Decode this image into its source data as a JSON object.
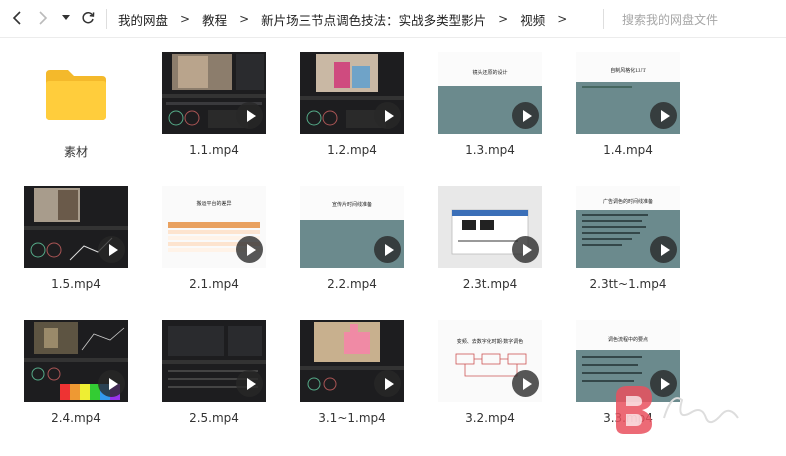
{
  "nav": {
    "back_icon": "chevron-left-icon",
    "forward_icon": "chevron-right-icon",
    "history_icon": "caret-down-icon",
    "refresh_icon": "refresh-icon"
  },
  "breadcrumb": [
    "我的网盘",
    "教程",
    "新片场三节点调色技法：实战多类型影片",
    "视频"
  ],
  "breadcrumb_separator": ">",
  "search": {
    "placeholder": "搜索我的网盘文件"
  },
  "items": [
    {
      "name": "素材",
      "type": "folder"
    },
    {
      "name": "1.1.mp4",
      "type": "video"
    },
    {
      "name": "1.2.mp4",
      "type": "video"
    },
    {
      "name": "1.3.mp4",
      "type": "video"
    },
    {
      "name": "1.4.mp4",
      "type": "video"
    },
    {
      "name": "1.5.mp4",
      "type": "video"
    },
    {
      "name": "2.1.mp4",
      "type": "video"
    },
    {
      "name": "2.2.mp4",
      "type": "video"
    },
    {
      "name": "2.3t.mp4",
      "type": "video"
    },
    {
      "name": "2.3tt~1.mp4",
      "type": "video"
    },
    {
      "name": "2.4.mp4",
      "type": "video"
    },
    {
      "name": "2.5.mp4",
      "type": "video"
    },
    {
      "name": "3.1~1.mp4",
      "type": "video"
    },
    {
      "name": "3.2.mp4",
      "type": "video"
    },
    {
      "name": "3.3.mp4",
      "type": "video"
    }
  ],
  "slide_titles": {
    "1.3": "镜头还原的设计",
    "1.4": "自制风格化LUT",
    "2.1": "搬运平台的差异",
    "2.2": "宣传片时间线准备",
    "2.3tt": "广告调色的时间线准备",
    "3.2": "变频、去数字化时期·数字调色",
    "3.3": "调色流程中的要点"
  },
  "colors": {
    "folder": "#ffc933",
    "slate": "#6b8a8d",
    "dark_ui": "#1d1d1f"
  }
}
